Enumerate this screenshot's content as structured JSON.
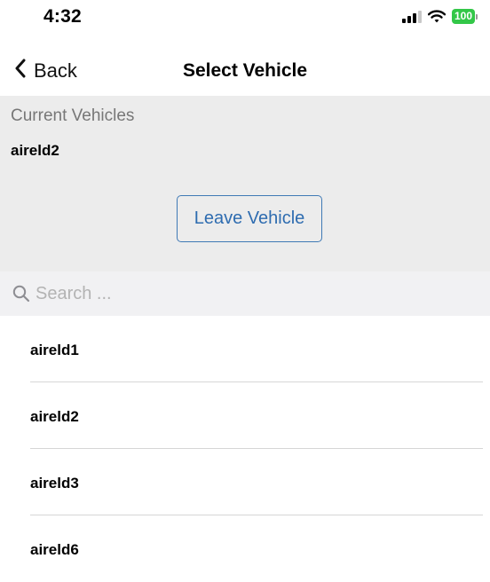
{
  "status_bar": {
    "time": "4:32",
    "battery": "100",
    "icons": [
      "signal-icon",
      "wifi-icon",
      "battery-icon"
    ]
  },
  "nav": {
    "back_label": "Back",
    "title": "Select Vehicle",
    "back_icon": "chevron-left-icon"
  },
  "current": {
    "heading": "Current Vehicles",
    "vehicle": "aireld2",
    "leave_label": "Leave Vehicle"
  },
  "search": {
    "placeholder": "Search ...",
    "value": "",
    "icon": "search-icon"
  },
  "vehicles": [
    {
      "label": "aireld1"
    },
    {
      "label": "aireld2"
    },
    {
      "label": "aireld3"
    },
    {
      "label": "aireld6"
    }
  ],
  "colors": {
    "accent": "#2e6cb0",
    "panel_background": "#ececec",
    "search_background": "#f1f1f3",
    "battery": "#33c748"
  }
}
